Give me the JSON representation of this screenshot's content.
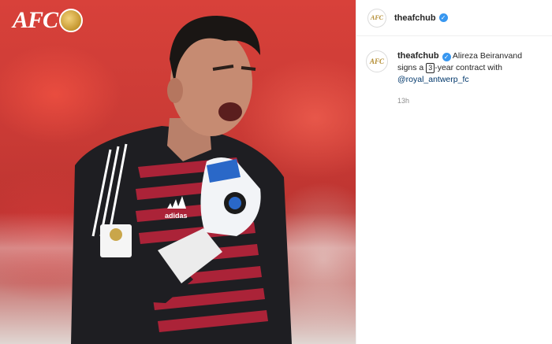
{
  "media": {
    "logo_text": "AFC",
    "logo_alt": "AFC Asian Cup logo",
    "kit_brand": "adidas",
    "badge_text": "AFC ASIAN CUP UAE 2019"
  },
  "post": {
    "username": "theafchub",
    "verified": true,
    "avatar_text": "AFC"
  },
  "caption": {
    "username": "theafchub",
    "text_before": "Alireza Beiranvand signs a ",
    "keycap": "3",
    "text_after": "-year contract with ",
    "mention": "@royal_antwerp_fc",
    "timestamp": "13h"
  },
  "colors": {
    "verified_blue": "#3897f0",
    "mention_blue": "#00376b",
    "stadium_red": "#c93a35"
  }
}
